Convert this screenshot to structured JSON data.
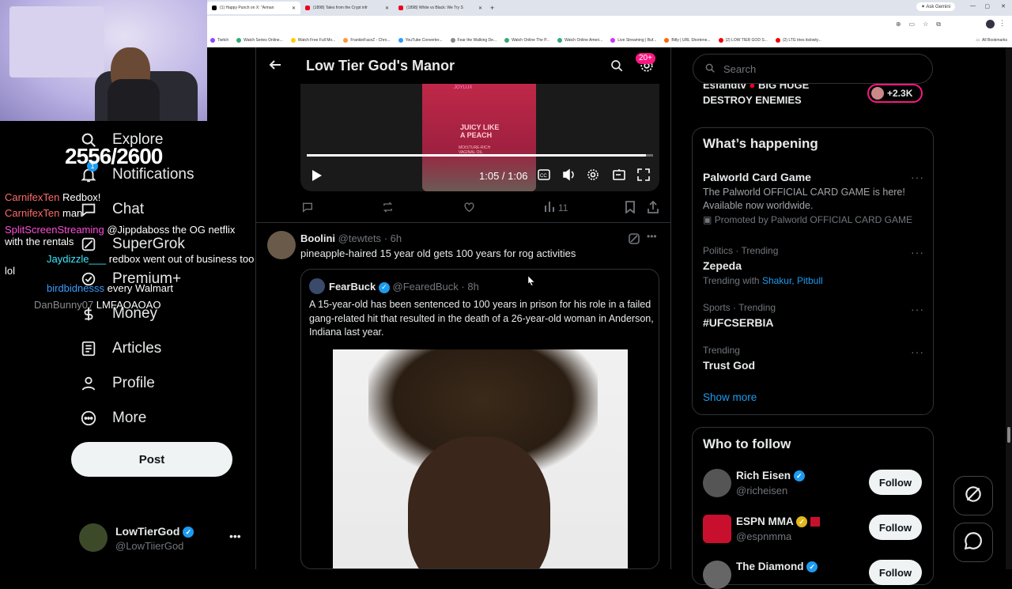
{
  "browser": {
    "tabs": [
      {
        "label": "(1) Happy Punch on X: \"Arman",
        "active": true
      },
      {
        "label": "(1898) Tales from the Crypt infr",
        "active": false
      },
      {
        "label": "(1898) White vs Black: We Try S",
        "active": false
      }
    ],
    "new_tab": "+",
    "ask_gemini": "Ask Gemini",
    "bookmarks": [
      "Twitch",
      "Watch Series Online...",
      "Watch Free Full Mo...",
      "FrankieFaceZ - Chro...",
      "YouTube Converter...",
      "Fear the Walking De...",
      "Watch Online The P...",
      "Watch Online Ameri...",
      "Live Streaming | Buf...",
      "Bitly | URL Shortene...",
      "(2) LOW TIER GOD S...",
      "(2) LTG tries itslowly..."
    ],
    "all_bookmarks": "All Bookmarks"
  },
  "stream_overlay": {
    "counter": "2556/2600",
    "chat": [
      {
        "user": "CarnifexTen",
        "user_color": "#ff6b6b",
        "msg": "Redbox!"
      },
      {
        "user": "CarnifexTen",
        "user_color": "#ff6b6b",
        "msg": "man"
      },
      {
        "user": "SplitScreenStreaming",
        "user_color": "#ff4fd8",
        "msg": "@Jippdaboss the OG netflix with the rentals"
      },
      {
        "user": "Jaydizzle___",
        "user_color": "#3be8ff",
        "msg": "redbox went out of business too lol"
      },
      {
        "user": "birdbidnesss",
        "user_color": "#3b9cff",
        "msg": "every Walmart"
      },
      {
        "user": "DanBunny07",
        "user_color": "#8a8a8a",
        "msg": "LMFAOAOAO"
      }
    ]
  },
  "nav": {
    "items": [
      {
        "label": "Explore",
        "icon": "search-icon"
      },
      {
        "label": "Notifications",
        "icon": "bell-icon",
        "badge": "1"
      },
      {
        "label": "Chat",
        "icon": "chat-icon"
      },
      {
        "label": "SuperGrok",
        "icon": "grok-icon"
      },
      {
        "label": "Premium+",
        "icon": "premium-icon"
      },
      {
        "label": "Money",
        "icon": "money-icon"
      },
      {
        "label": "Articles",
        "icon": "articles-icon"
      },
      {
        "label": "Profile",
        "icon": "profile-icon"
      },
      {
        "label": "More",
        "icon": "more-icon"
      }
    ],
    "post_label": "Post",
    "account": {
      "name": "LowTierGod",
      "handle": "@LowTiierGod"
    }
  },
  "header": {
    "title": "Low Tier God's Manor",
    "badge": "20+"
  },
  "video": {
    "time": "1:05 / 1:06",
    "progress": 0.98,
    "overlay_text": "JUICY LIKE A PEACH",
    "overlay_small": "MOISTURE-RICH VAGINAL OIL",
    "brand": "JOYLUX",
    "views": "11"
  },
  "post": {
    "name": "Boolini",
    "handle": "@tewtets",
    "time": "6h",
    "text": "pineapple-haired 15 year old gets 100 years for rog activities",
    "quote": {
      "name": "FearBuck",
      "handle": "@FearedBuck",
      "time": "8h",
      "text": "A 15-year-old has been sentenced to 100 years in prison for his role in a failed gang-related hit that resulted in the death of a 26-year-old woman in Anderson, Indiana last year."
    }
  },
  "sidebar": {
    "search_placeholder": "Search",
    "promo": {
      "line1": "Esfandtv",
      "line2": "BIG HUGE",
      "line3": "DESTROY ENEMIES",
      "count": "+2.3K"
    },
    "happening_title": "What’s happening",
    "trends": [
      {
        "title": "Palworld Card Game",
        "desc": "The Palworld OFFICIAL CARD GAME is here! Available now worldwide.",
        "promoted": "Promoted by Palworld OFFICIAL CARD GAME"
      },
      {
        "meta": "Politics · Trending",
        "title": "Zepeda",
        "with_prefix": "Trending with",
        "with": "Shakur, Pitbull"
      },
      {
        "meta": "Sports · Trending",
        "title": "#UFCSERBIA"
      },
      {
        "meta": "Trending",
        "title": "Trust God"
      }
    ],
    "show_more": "Show more",
    "follow_title": "Who to follow",
    "follow": [
      {
        "name": "Rich Eisen",
        "handle": "@richeisen",
        "button": "Follow"
      },
      {
        "name": "ESPN MMA",
        "handle": "@espnmma",
        "button": "Follow"
      },
      {
        "name": "The Diamond",
        "handle": "",
        "button": "Follow"
      }
    ]
  },
  "colors": {
    "accent": "#1d9bf0",
    "badge_pink": "#f91880",
    "link": "#1d9bf0"
  }
}
